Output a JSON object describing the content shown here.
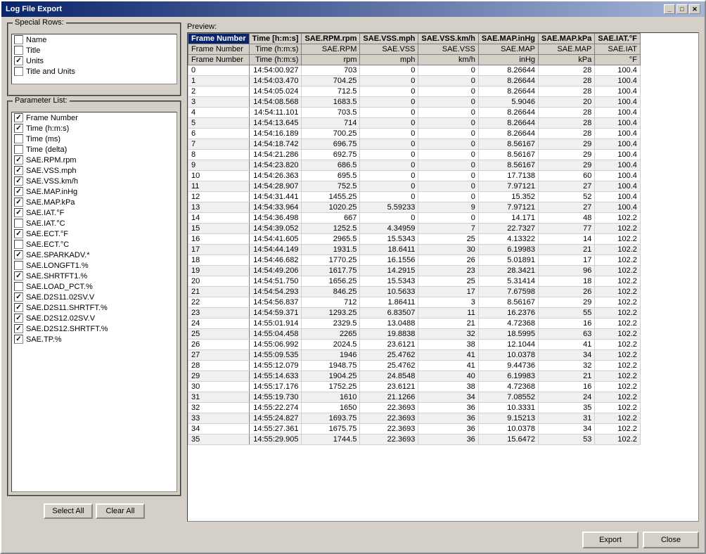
{
  "window": {
    "title": "Log File Export",
    "title_buttons": [
      "_",
      "□",
      "✕"
    ]
  },
  "left_panel": {
    "special_rows_label": "Special Rows:",
    "special_rows": [
      {
        "label": "Name",
        "checked": false
      },
      {
        "label": "Title",
        "checked": false
      },
      {
        "label": "Units",
        "checked": true
      },
      {
        "label": "Title and Units",
        "checked": false
      }
    ],
    "param_list_label": "Parameter List:",
    "params": [
      {
        "label": "Frame Number",
        "checked": true
      },
      {
        "label": "Time (h:m:s)",
        "checked": true
      },
      {
        "label": "Time (ms)",
        "checked": false
      },
      {
        "label": "Time (delta)",
        "checked": false
      },
      {
        "label": "SAE.RPM.rpm",
        "checked": true
      },
      {
        "label": "SAE.VSS.mph",
        "checked": true
      },
      {
        "label": "SAE.VSS.km/h",
        "checked": true
      },
      {
        "label": "SAE.MAP.inHg",
        "checked": true
      },
      {
        "label": "SAE.MAP.kPa",
        "checked": true
      },
      {
        "label": "SAE.IAT.°F",
        "checked": true
      },
      {
        "label": "SAE.IAT.°C",
        "checked": false
      },
      {
        "label": "SAE.ECT.°F",
        "checked": true
      },
      {
        "label": "SAE.ECT.°C",
        "checked": false
      },
      {
        "label": "SAE.SPARKADV.*",
        "checked": true
      },
      {
        "label": "SAE.LONGFT1.%",
        "checked": false
      },
      {
        "label": "SAE.SHRTFT1.%",
        "checked": true
      },
      {
        "label": "SAE.LOAD_PCT.%",
        "checked": false
      },
      {
        "label": "SAE.D2S11.02SV.V",
        "checked": true
      },
      {
        "label": "SAE.D2S11.SHRTFT.%",
        "checked": true
      },
      {
        "label": "SAE.D2S12.02SV.V",
        "checked": true
      },
      {
        "label": "SAE.D2S12.SHRTFT.%",
        "checked": true
      },
      {
        "label": "SAE.TP.%",
        "checked": true
      }
    ],
    "select_all_btn": "Select All",
    "clear_all_btn": "Clear All"
  },
  "preview": {
    "label": "Preview:",
    "header1": [
      "Frame Number",
      "Time [h:m:s]",
      "SAE.RPM.rpm",
      "SAE.VSS.mph",
      "SAE.VSS.km/h",
      "SAE.MAP.inHg",
      "SAE.MAP.kPa",
      "SAE.IAT.°F"
    ],
    "header1_selected": 0,
    "header2": [
      "Frame Number",
      "Time (h:m:s)",
      "SAE.RPM",
      "SAE.VSS",
      "SAE.VSS",
      "SAE.MAP",
      "SAE.MAP",
      "SAE.IAT"
    ],
    "header3": [
      "Frame Number",
      "Time (h:m:s)",
      "rpm",
      "mph",
      "km/h",
      "inHg",
      "kPa",
      "°F"
    ],
    "rows": [
      [
        0,
        "14:54:00.927",
        703,
        0,
        0,
        "8.26644",
        28,
        100.4
      ],
      [
        1,
        "14:54:03.470",
        "704.25",
        0,
        0,
        "8.26644",
        28,
        100.4
      ],
      [
        2,
        "14:54:05.024",
        "712.5",
        0,
        0,
        "8.26644",
        28,
        100.4
      ],
      [
        3,
        "14:54:08.568",
        "1683.5",
        0,
        0,
        "5.9046",
        20,
        100.4
      ],
      [
        4,
        "14:54:11.101",
        "703.5",
        0,
        0,
        "8.26644",
        28,
        100.4
      ],
      [
        5,
        "14:54:13.645",
        714,
        0,
        0,
        "8.26644",
        28,
        100.4
      ],
      [
        6,
        "14:54:16.189",
        "700.25",
        0,
        0,
        "8.26644",
        28,
        100.4
      ],
      [
        7,
        "14:54:18.742",
        "696.75",
        0,
        0,
        "8.56167",
        29,
        100.4
      ],
      [
        8,
        "14:54:21.286",
        "692.75",
        0,
        0,
        "8.56167",
        29,
        100.4
      ],
      [
        9,
        "14:54:23.820",
        "686.5",
        0,
        0,
        "8.56167",
        29,
        100.4
      ],
      [
        10,
        "14:54:26.363",
        "695.5",
        0,
        0,
        "17.7138",
        60,
        100.4
      ],
      [
        11,
        "14:54:28.907",
        "752.5",
        0,
        0,
        "7.97121",
        27,
        100.4
      ],
      [
        12,
        "14:54:31.441",
        "1455.25",
        0,
        0,
        "15.352",
        52,
        100.4
      ],
      [
        13,
        "14:54:33.964",
        "1020.25",
        "5.59233",
        9,
        "7.97121",
        27,
        100.4
      ],
      [
        14,
        "14:54:36.498",
        667,
        0,
        0,
        "14.171",
        48,
        102.2
      ],
      [
        15,
        "14:54:39.052",
        "1252.5",
        "4.34959",
        7,
        "22.7327",
        77,
        102.2
      ],
      [
        16,
        "14:54:41.605",
        "2965.5",
        "15.5343",
        25,
        "4.13322",
        14,
        102.2
      ],
      [
        17,
        "14:54:44.149",
        "1931.5",
        "18.6411",
        30,
        "6.19983",
        21,
        102.2
      ],
      [
        18,
        "14:54:46.682",
        "1770.25",
        "16.1556",
        26,
        "5.01891",
        17,
        102.2
      ],
      [
        19,
        "14:54:49.206",
        "1617.75",
        "14.2915",
        23,
        "28.3421",
        96,
        102.2
      ],
      [
        20,
        "14:54:51.750",
        "1656.25",
        "15.5343",
        25,
        "5.31414",
        18,
        102.2
      ],
      [
        21,
        "14:54:54.293",
        "846.25",
        "10.5633",
        17,
        "7.67598",
        26,
        102.2
      ],
      [
        22,
        "14:54:56.837",
        712,
        "1.86411",
        3,
        "8.56167",
        29,
        102.2
      ],
      [
        23,
        "14:54:59.371",
        "1293.25",
        "6.83507",
        11,
        "16.2376",
        55,
        102.2
      ],
      [
        24,
        "14:55:01.914",
        "2329.5",
        "13.0488",
        21,
        "4.72368",
        16,
        102.2
      ],
      [
        25,
        "14:55:04.458",
        2265,
        "19.8838",
        32,
        "18.5995",
        63,
        102.2
      ],
      [
        26,
        "14:55:06.992",
        "2024.5",
        "23.6121",
        38,
        "12.1044",
        41,
        102.2
      ],
      [
        27,
        "14:55:09.535",
        1946,
        "25.4762",
        41,
        "10.0378",
        34,
        102.2
      ],
      [
        28,
        "14:55:12.079",
        "1948.75",
        "25.4762",
        41,
        "9.44736",
        32,
        102.2
      ],
      [
        29,
        "14:55:14.633",
        "1904.25",
        "24.8548",
        40,
        "6.19983",
        21,
        102.2
      ],
      [
        30,
        "14:55:17.176",
        "1752.25",
        "23.6121",
        38,
        "4.72368",
        16,
        102.2
      ],
      [
        31,
        "14:55:19.730",
        1610,
        "21.1266",
        34,
        "7.08552",
        24,
        102.2
      ],
      [
        32,
        "14:55:22.274",
        1650,
        "22.3693",
        36,
        "10.3331",
        35,
        102.2
      ],
      [
        33,
        "14:55:24.827",
        "1693.75",
        "22.3693",
        36,
        "9.15213",
        31,
        102.2
      ],
      [
        34,
        "14:55:27.361",
        "1675.75",
        "22.3693",
        36,
        "10.0378",
        34,
        102.2
      ],
      [
        35,
        "14:55:29.905",
        "1744.5",
        "22.3693",
        36,
        "15.6472",
        53,
        "102.2"
      ]
    ]
  },
  "footer": {
    "export_btn": "Export",
    "close_btn": "Close"
  }
}
